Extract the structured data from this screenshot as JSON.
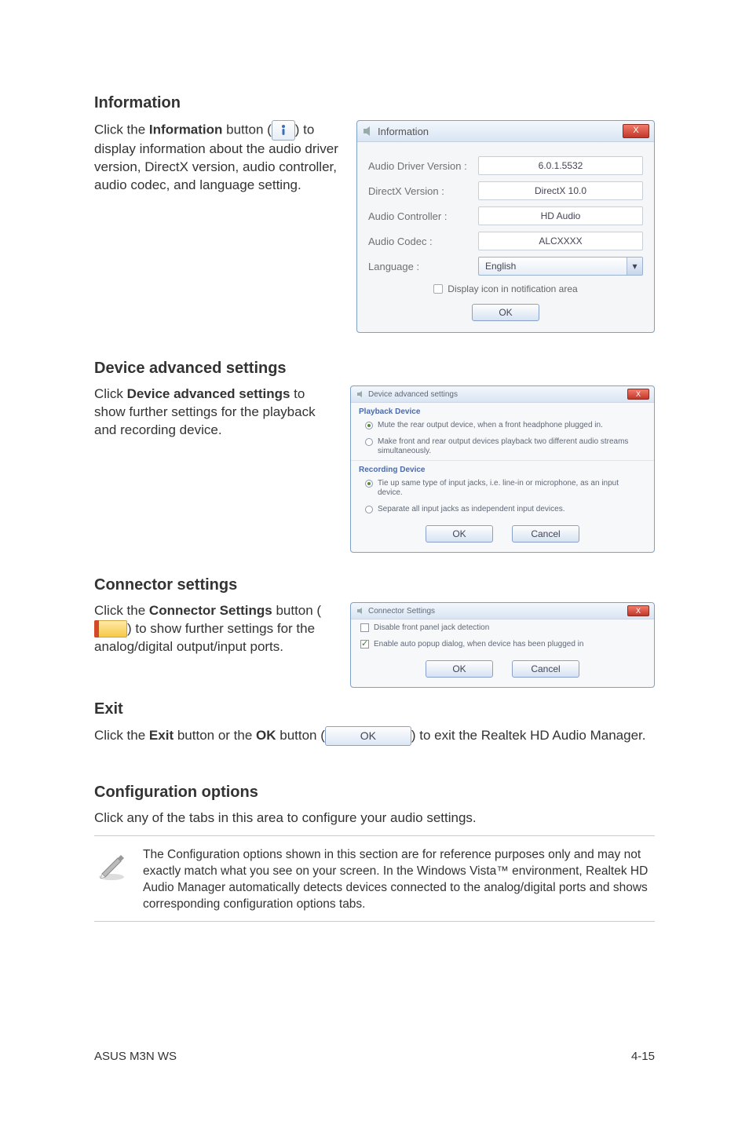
{
  "s1": {
    "heading": "Information",
    "p_before": "Click the ",
    "p_bold": "Information",
    "p_mid": " button (",
    "p_after": ") to display information about the audio driver version, DirectX version, audio controller, audio codec, and language setting."
  },
  "info_win": {
    "title": "Information",
    "close": "X",
    "rows": {
      "r1_label": "Audio Driver Version :",
      "r1_val": "6.0.1.5532",
      "r2_label": "DirectX Version :",
      "r2_val": "DirectX 10.0",
      "r3_label": "Audio Controller :",
      "r3_val": "HD Audio",
      "r4_label": "Audio Codec :",
      "r4_val": "ALCXXXX",
      "r5_label": "Language :",
      "r5_val": "English"
    },
    "checkbox": "Display icon in notification area",
    "ok": "OK"
  },
  "s2": {
    "heading": "Device advanced settings",
    "p_before": "Click ",
    "p_bold": "Device advanced settings",
    "p_after": " to show further settings for the playback and recording device."
  },
  "adv_win": {
    "title": "Device advanced settings",
    "close": "X",
    "playback_h": "Playback Device",
    "p_opt1": "Mute the rear output device, when a front headphone plugged in.",
    "p_opt2": "Make front and rear output devices playback two different audio streams simultaneously.",
    "record_h": "Recording Device",
    "r_opt1": "Tie up same type of input jacks, i.e. line-in or microphone, as an input device.",
    "r_opt2": "Separate all input jacks as independent input devices.",
    "ok": "OK",
    "cancel": "Cancel"
  },
  "s3": {
    "heading": "Connector settings",
    "p_before": "Click the ",
    "p_bold": "Connector Settings",
    "p_mid": " button (",
    "p_after": ") to show further settings for the analog/digital output/input ports."
  },
  "conn_win": {
    "title": "Connector Settings",
    "close": "X",
    "opt1": "Disable front panel jack detection",
    "opt2": "Enable auto popup dialog, when device has been plugged in",
    "ok": "OK",
    "cancel": "Cancel"
  },
  "s4": {
    "heading": "Exit",
    "p_before": "Click the ",
    "p_b1": "Exit",
    "p_mid1": " button or the ",
    "p_b2": "OK",
    "p_mid2": " button (",
    "ok_btn": "OK",
    "p_after": ") to exit the Realtek HD Audio Manager."
  },
  "s5": {
    "heading": "Configuration options",
    "intro": "Click any of the tabs in this area to configure your audio settings.",
    "note": "The Configuration options shown in this section are for reference purposes only and may not exactly match what you see on your screen. In the Windows Vista™ environment, Realtek HD Audio Manager automatically detects devices connected to the analog/digital ports and shows corresponding  configuration options tabs."
  },
  "footer": {
    "left": "ASUS M3N WS",
    "right": "4-15"
  }
}
